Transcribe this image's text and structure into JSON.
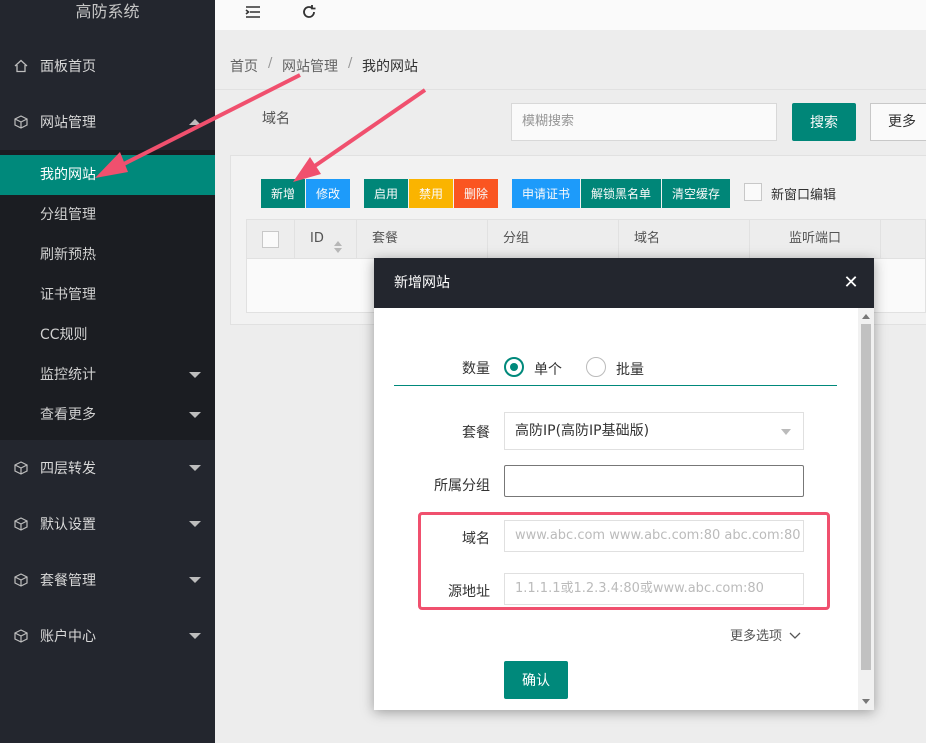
{
  "sidebar": {
    "logo": "高防系统",
    "items": [
      {
        "label": "面板首页"
      },
      {
        "label": "网站管理"
      },
      {
        "label": "四层转发"
      },
      {
        "label": "默认设置"
      },
      {
        "label": "套餐管理"
      },
      {
        "label": "账户中心"
      }
    ],
    "submenu": [
      {
        "label": "我的网站"
      },
      {
        "label": "分组管理"
      },
      {
        "label": "刷新预热"
      },
      {
        "label": "证书管理"
      },
      {
        "label": "CC规则"
      },
      {
        "label": "监控统计"
      },
      {
        "label": "查看更多"
      }
    ]
  },
  "header": {
    "menu_icon": "☰",
    "refresh_icon": "↻"
  },
  "breadcrumb": {
    "items": [
      "首页",
      "网站管理",
      "我的网站"
    ],
    "sep": "/"
  },
  "search": {
    "label": "域名",
    "placeholder": "模糊搜索",
    "search_btn": "搜索",
    "more_btn": "更多"
  },
  "toolbar": {
    "buttons": [
      {
        "label": "新增",
        "color": "#00897b"
      },
      {
        "label": "修改",
        "color": "#1e9fff"
      },
      {
        "label": "启用",
        "color": "#00897b"
      },
      {
        "label": "禁用",
        "color": "#ffb800"
      },
      {
        "label": "删除",
        "color": "#ff5722"
      },
      {
        "label": "申请证书",
        "color": "#1e9fff"
      },
      {
        "label": "解锁黑名单",
        "color": "#00897b"
      },
      {
        "label": "清空缓存",
        "color": "#00897b"
      }
    ],
    "new_window_label": "新窗口编辑"
  },
  "table": {
    "columns": [
      "ID",
      "套餐",
      "分组",
      "域名",
      "监听端口"
    ]
  },
  "modal": {
    "title": "新增网站",
    "close": "✕",
    "quantity_label": "数量",
    "quantity_options": [
      "单个",
      "批量"
    ],
    "plan_label": "套餐",
    "plan_value": "高防IP(高防IP基础版)",
    "group_label": "所属分组",
    "group_value": "",
    "domain_label": "域名",
    "domain_placeholder": "www.abc.com www.abc.com:80 abc.com:80",
    "origin_label": "源地址",
    "origin_placeholder": "1.1.1.1或1.2.3.4:80或www.abc.com:80",
    "more_options": "更多选项",
    "confirm": "确认"
  },
  "colors": {
    "primary": "#00897b",
    "sidebar": "#23262e",
    "highlight": "#f0506e"
  }
}
